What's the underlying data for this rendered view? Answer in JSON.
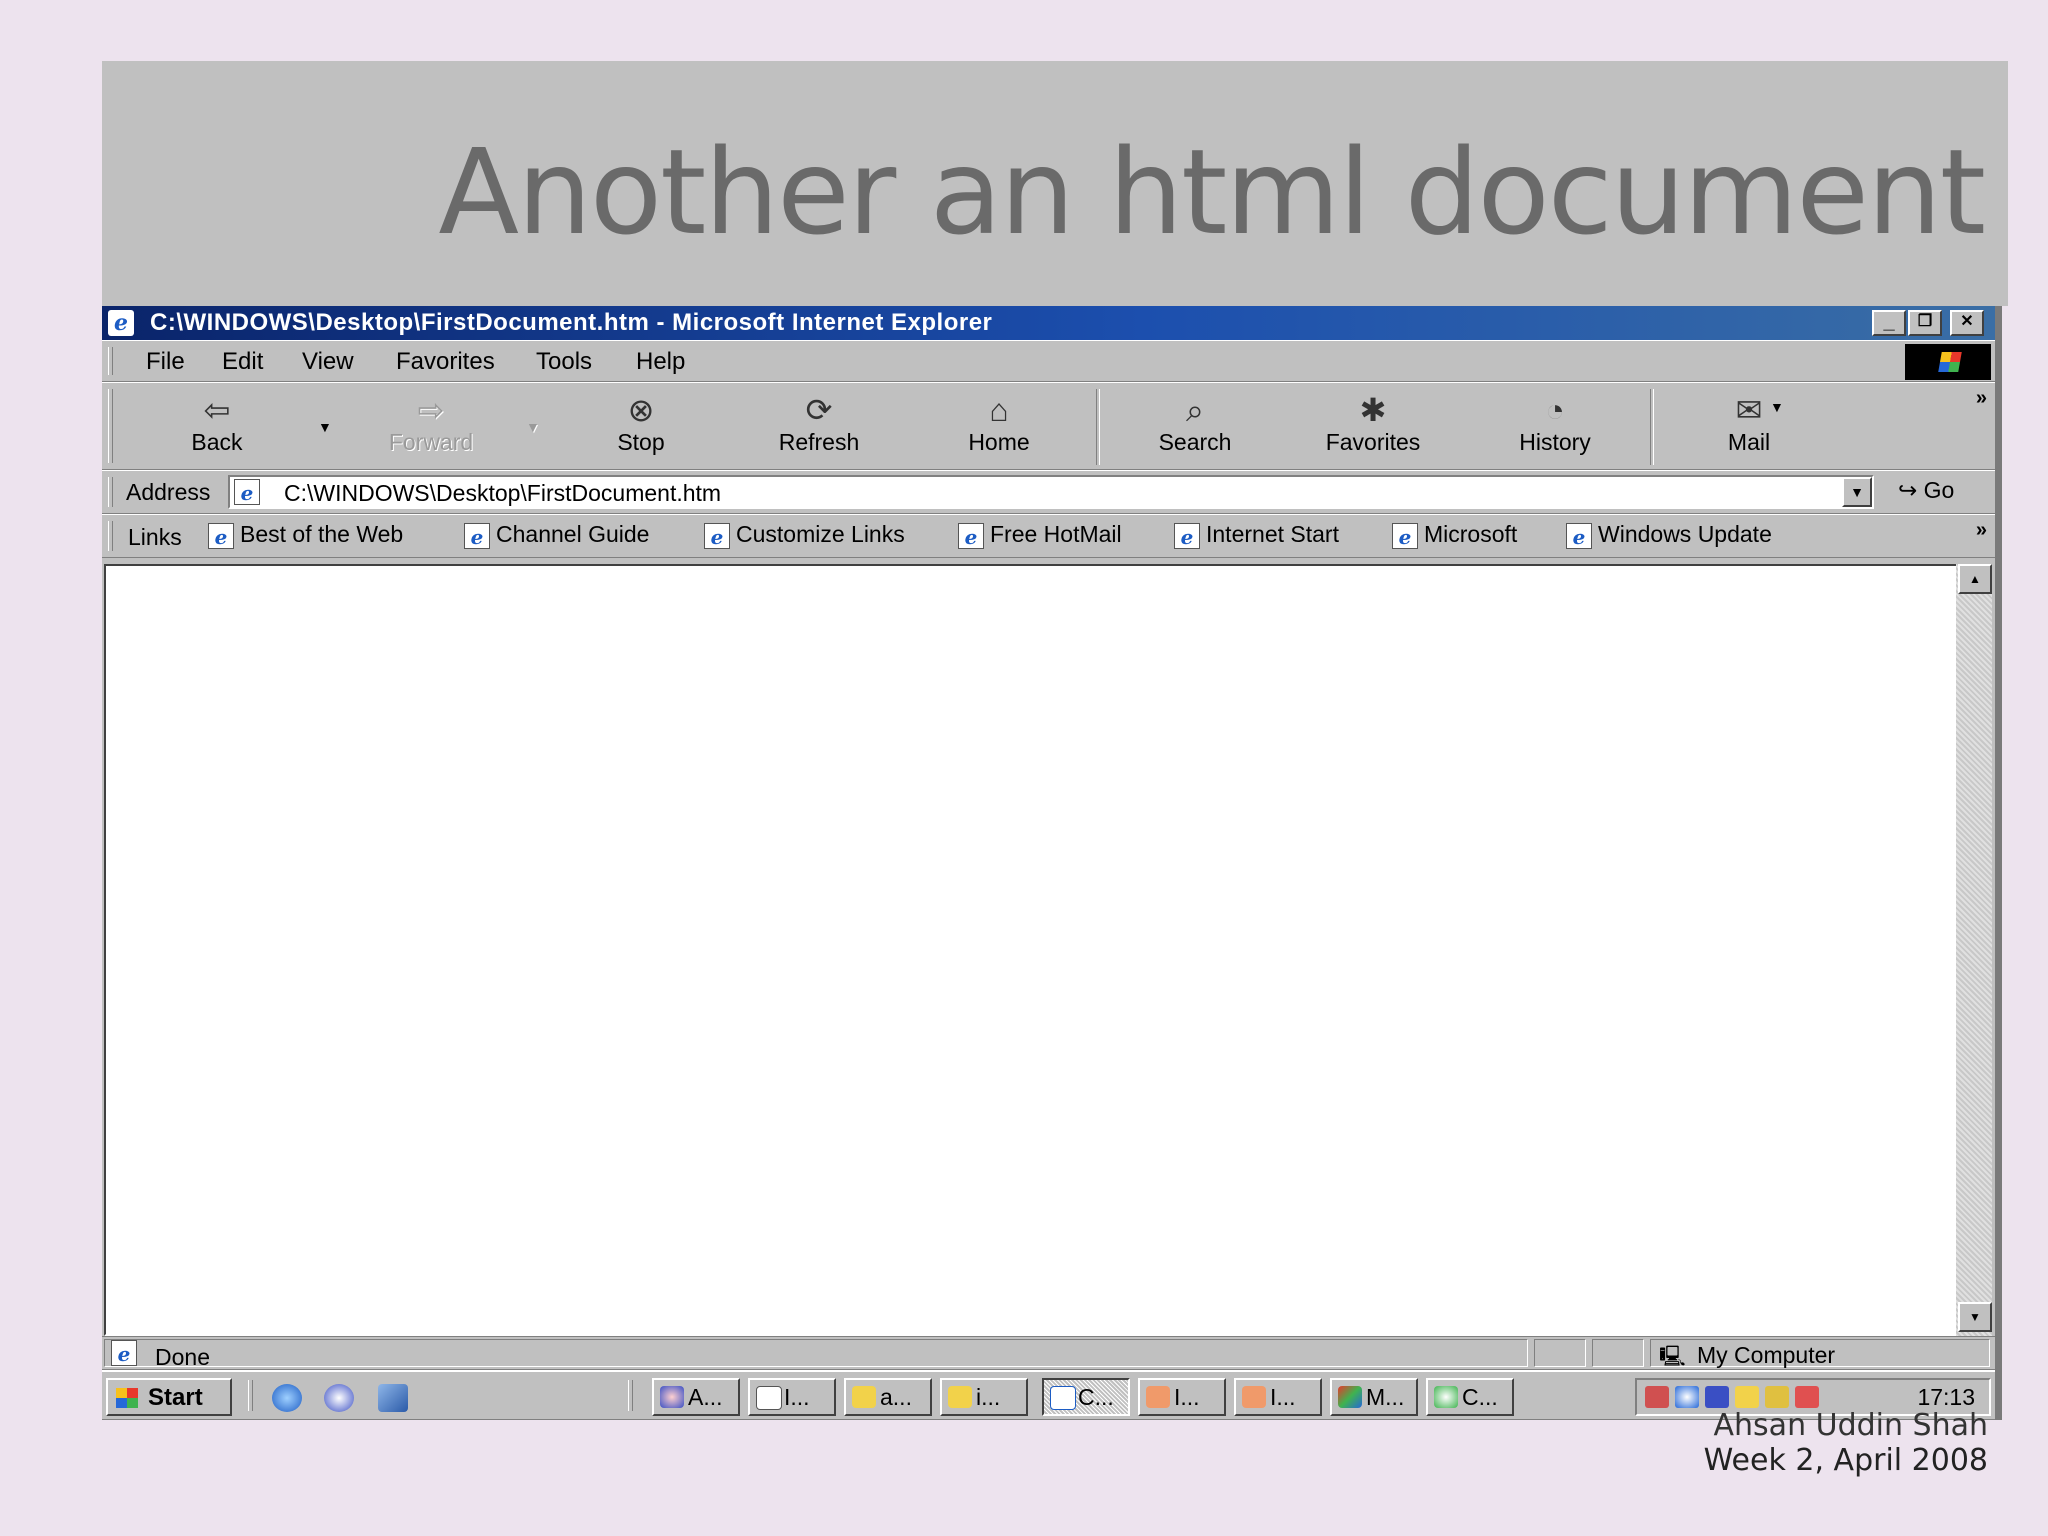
{
  "slide": {
    "title": "Another an html document",
    "author": "Ahsan Uddin Shah",
    "date": "Week 2, April 2008"
  },
  "window": {
    "title": "C:\\WINDOWS\\Desktop\\FirstDocument.htm - Microsoft Internet Explorer",
    "controls": {
      "minimize": "_",
      "restore": "❐",
      "close": "✕"
    }
  },
  "menu": [
    "File",
    "Edit",
    "View",
    "Favorites",
    "Tools",
    "Help"
  ],
  "toolbar": {
    "back": "Back",
    "forward": "Forward",
    "stop": "Stop",
    "refresh": "Refresh",
    "home": "Home",
    "search": "Search",
    "favorites": "Favorites",
    "history": "History",
    "mail": "Mail"
  },
  "address": {
    "label": "Address",
    "value": "C:\\WINDOWS\\Desktop\\FirstDocument.htm",
    "go": "Go"
  },
  "links": {
    "label": "Links",
    "items": [
      "Best of the Web",
      "Channel Guide",
      "Customize Links",
      "Free HotMail",
      "Internet Start",
      "Microsoft",
      "Windows Update"
    ]
  },
  "status": {
    "text": "Done",
    "zone": "My Computer"
  },
  "taskbar": {
    "start": "Start",
    "tasks": [
      "A...",
      "I...",
      "a...",
      "i...",
      "C...",
      "I...",
      "I...",
      "M...",
      "C..."
    ],
    "clock": "17:13"
  },
  "colors": {
    "slide_background": "#ede3ee",
    "header_band": "#c0c0c0",
    "titlebar_start": "#0a246a",
    "titlebar_end": "#3a6ea5",
    "window_face": "#c0c0c0"
  }
}
